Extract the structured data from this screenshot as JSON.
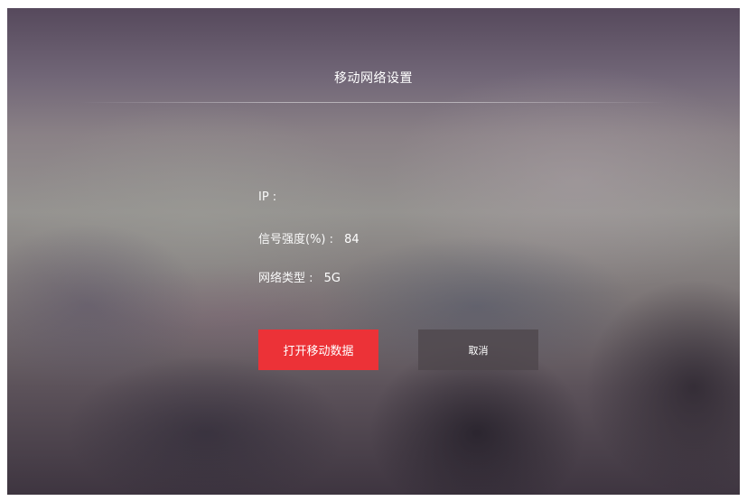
{
  "dialog": {
    "title": "移动网络设置"
  },
  "info": {
    "ip_label": "IP :",
    "ip_value": "",
    "signal_label": "信号强度(%) :",
    "signal_value": "84",
    "network_type_label": "网络类型 :",
    "network_type_value": "5G"
  },
  "actions": {
    "enable_label": "打开移动数据",
    "cancel_label": "取消"
  },
  "colors": {
    "primary_button": "#ec3237",
    "cancel_button": "#4e464c",
    "text": "#ffffff"
  }
}
